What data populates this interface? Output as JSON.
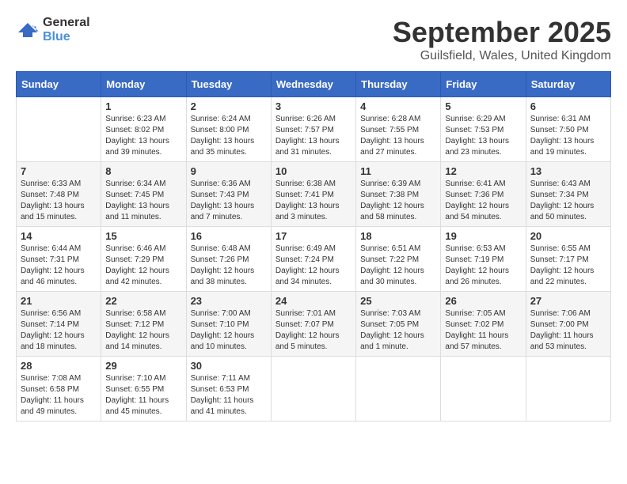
{
  "logo": {
    "general": "General",
    "blue": "Blue"
  },
  "title": "September 2025",
  "location": "Guilsfield, Wales, United Kingdom",
  "headers": [
    "Sunday",
    "Monday",
    "Tuesday",
    "Wednesday",
    "Thursday",
    "Friday",
    "Saturday"
  ],
  "weeks": [
    [
      {
        "day": "",
        "info": ""
      },
      {
        "day": "1",
        "info": "Sunrise: 6:23 AM\nSunset: 8:02 PM\nDaylight: 13 hours\nand 39 minutes."
      },
      {
        "day": "2",
        "info": "Sunrise: 6:24 AM\nSunset: 8:00 PM\nDaylight: 13 hours\nand 35 minutes."
      },
      {
        "day": "3",
        "info": "Sunrise: 6:26 AM\nSunset: 7:57 PM\nDaylight: 13 hours\nand 31 minutes."
      },
      {
        "day": "4",
        "info": "Sunrise: 6:28 AM\nSunset: 7:55 PM\nDaylight: 13 hours\nand 27 minutes."
      },
      {
        "day": "5",
        "info": "Sunrise: 6:29 AM\nSunset: 7:53 PM\nDaylight: 13 hours\nand 23 minutes."
      },
      {
        "day": "6",
        "info": "Sunrise: 6:31 AM\nSunset: 7:50 PM\nDaylight: 13 hours\nand 19 minutes."
      }
    ],
    [
      {
        "day": "7",
        "info": "Sunrise: 6:33 AM\nSunset: 7:48 PM\nDaylight: 13 hours\nand 15 minutes."
      },
      {
        "day": "8",
        "info": "Sunrise: 6:34 AM\nSunset: 7:45 PM\nDaylight: 13 hours\nand 11 minutes."
      },
      {
        "day": "9",
        "info": "Sunrise: 6:36 AM\nSunset: 7:43 PM\nDaylight: 13 hours\nand 7 minutes."
      },
      {
        "day": "10",
        "info": "Sunrise: 6:38 AM\nSunset: 7:41 PM\nDaylight: 13 hours\nand 3 minutes."
      },
      {
        "day": "11",
        "info": "Sunrise: 6:39 AM\nSunset: 7:38 PM\nDaylight: 12 hours\nand 58 minutes."
      },
      {
        "day": "12",
        "info": "Sunrise: 6:41 AM\nSunset: 7:36 PM\nDaylight: 12 hours\nand 54 minutes."
      },
      {
        "day": "13",
        "info": "Sunrise: 6:43 AM\nSunset: 7:34 PM\nDaylight: 12 hours\nand 50 minutes."
      }
    ],
    [
      {
        "day": "14",
        "info": "Sunrise: 6:44 AM\nSunset: 7:31 PM\nDaylight: 12 hours\nand 46 minutes."
      },
      {
        "day": "15",
        "info": "Sunrise: 6:46 AM\nSunset: 7:29 PM\nDaylight: 12 hours\nand 42 minutes."
      },
      {
        "day": "16",
        "info": "Sunrise: 6:48 AM\nSunset: 7:26 PM\nDaylight: 12 hours\nand 38 minutes."
      },
      {
        "day": "17",
        "info": "Sunrise: 6:49 AM\nSunset: 7:24 PM\nDaylight: 12 hours\nand 34 minutes."
      },
      {
        "day": "18",
        "info": "Sunrise: 6:51 AM\nSunset: 7:22 PM\nDaylight: 12 hours\nand 30 minutes."
      },
      {
        "day": "19",
        "info": "Sunrise: 6:53 AM\nSunset: 7:19 PM\nDaylight: 12 hours\nand 26 minutes."
      },
      {
        "day": "20",
        "info": "Sunrise: 6:55 AM\nSunset: 7:17 PM\nDaylight: 12 hours\nand 22 minutes."
      }
    ],
    [
      {
        "day": "21",
        "info": "Sunrise: 6:56 AM\nSunset: 7:14 PM\nDaylight: 12 hours\nand 18 minutes."
      },
      {
        "day": "22",
        "info": "Sunrise: 6:58 AM\nSunset: 7:12 PM\nDaylight: 12 hours\nand 14 minutes."
      },
      {
        "day": "23",
        "info": "Sunrise: 7:00 AM\nSunset: 7:10 PM\nDaylight: 12 hours\nand 10 minutes."
      },
      {
        "day": "24",
        "info": "Sunrise: 7:01 AM\nSunset: 7:07 PM\nDaylight: 12 hours\nand 5 minutes."
      },
      {
        "day": "25",
        "info": "Sunrise: 7:03 AM\nSunset: 7:05 PM\nDaylight: 12 hours\nand 1 minute."
      },
      {
        "day": "26",
        "info": "Sunrise: 7:05 AM\nSunset: 7:02 PM\nDaylight: 11 hours\nand 57 minutes."
      },
      {
        "day": "27",
        "info": "Sunrise: 7:06 AM\nSunset: 7:00 PM\nDaylight: 11 hours\nand 53 minutes."
      }
    ],
    [
      {
        "day": "28",
        "info": "Sunrise: 7:08 AM\nSunset: 6:58 PM\nDaylight: 11 hours\nand 49 minutes."
      },
      {
        "day": "29",
        "info": "Sunrise: 7:10 AM\nSunset: 6:55 PM\nDaylight: 11 hours\nand 45 minutes."
      },
      {
        "day": "30",
        "info": "Sunrise: 7:11 AM\nSunset: 6:53 PM\nDaylight: 11 hours\nand 41 minutes."
      },
      {
        "day": "",
        "info": ""
      },
      {
        "day": "",
        "info": ""
      },
      {
        "day": "",
        "info": ""
      },
      {
        "day": "",
        "info": ""
      }
    ]
  ]
}
